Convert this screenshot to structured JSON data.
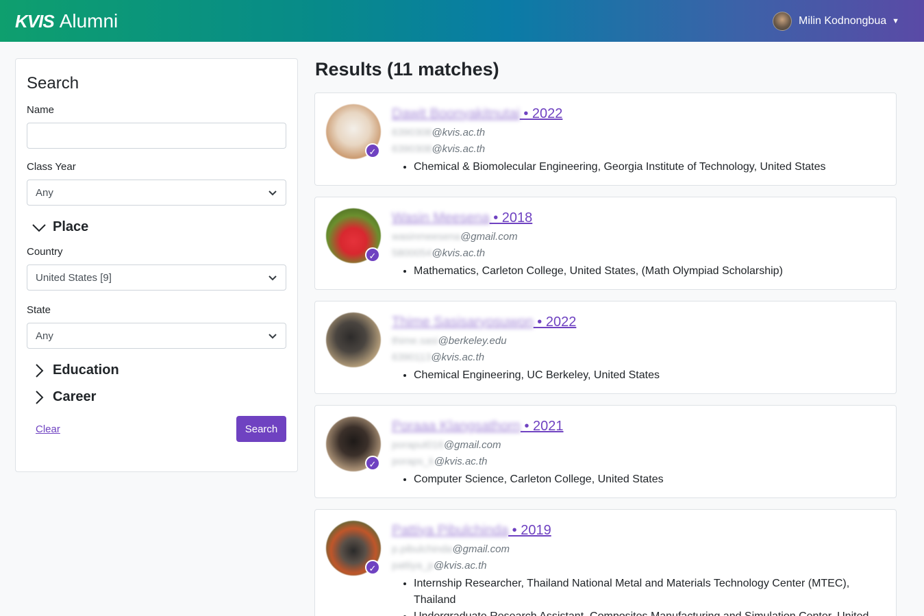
{
  "header": {
    "brand_logo": "KVIS",
    "brand_text": "Alumni",
    "user_name": "Milin Kodnongbua"
  },
  "sidebar": {
    "title": "Search",
    "name_label": "Name",
    "name_value": "",
    "class_year_label": "Class Year",
    "class_year_value": "Any",
    "place_label": "Place",
    "country_label": "Country",
    "country_value": "United States [9]",
    "state_label": "State",
    "state_value": "Any",
    "education_label": "Education",
    "career_label": "Career",
    "clear_label": "Clear",
    "search_label": "Search"
  },
  "results": {
    "title": "Results (11 matches)",
    "items": [
      {
        "name": "Dawit Boonyakitnutai",
        "year": " • 2022",
        "email1_user": "6390308",
        "email1_domain": "@kvis.ac.th",
        "email2_user": "6390308",
        "email2_domain": "@kvis.ac.th",
        "lines": [
          "Chemical & Biomolecular Engineering, Georgia Institute of Technology, United States"
        ]
      },
      {
        "name": "Wasin Meesena",
        "year": " • 2018",
        "email1_user": "wasinmeesena",
        "email1_domain": "@gmail.com",
        "email2_user": "5800054",
        "email2_domain": "@kvis.ac.th",
        "lines": [
          "Mathematics, Carleton College, United States, (Math Olympiad Scholarship)"
        ]
      },
      {
        "name": "Thime Sasisaryosuwon",
        "year": " • 2022",
        "email1_user": "thime.sasi",
        "email1_domain": "@berkeley.edu",
        "email2_user": "6390113",
        "email2_domain": "@kvis.ac.th",
        "lines": [
          "Chemical Engineering, UC Berkeley, United States"
        ]
      },
      {
        "name": "Poraaa Klangsathorn",
        "year": " • 2021",
        "email1_user": "poraput016",
        "email1_domain": "@gmail.com",
        "email2_user": "poraps_k",
        "email2_domain": "@kvis.ac.th",
        "lines": [
          "Computer Science, Carleton College, United States"
        ]
      },
      {
        "name": "Pattiya Pibulchinda",
        "year": " • 2019",
        "email1_user": "p.pibulchinda",
        "email1_domain": "@gmail.com",
        "email2_user": "pattiya_p",
        "email2_domain": "@kvis.ac.th",
        "lines": [
          "Internship Researcher, Thailand National Metal and Materials Technology Center (MTEC), Thailand",
          "Undergraduate Research Assistant, Composites Manufacturing and Simulation Center, United States"
        ]
      }
    ]
  }
}
